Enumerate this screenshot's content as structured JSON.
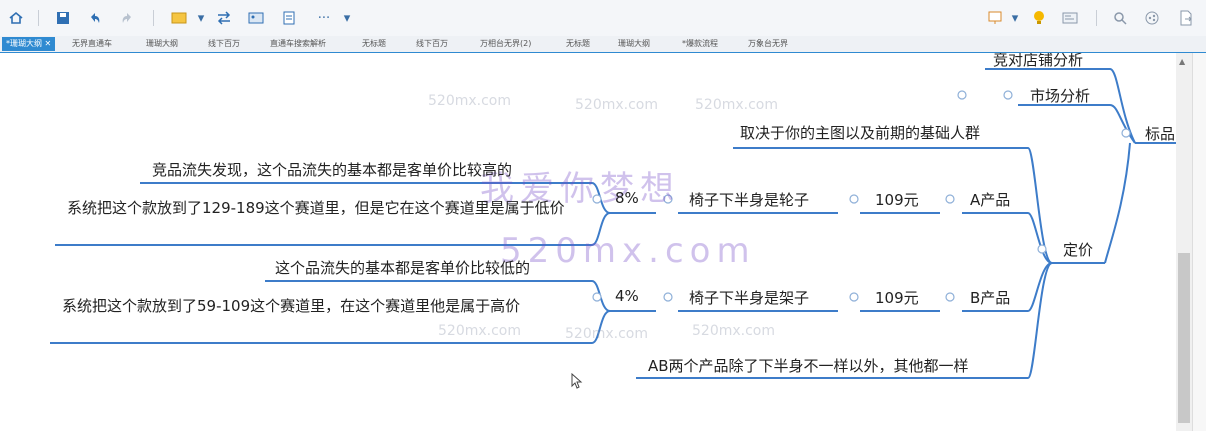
{
  "tabs": [
    {
      "label": "*珊瑚大纲 ✕",
      "active": true
    },
    {
      "label": "无界直通车",
      "active": false
    },
    {
      "label": "珊瑚大纲",
      "active": false
    },
    {
      "label": "线下百万",
      "active": false
    },
    {
      "label": "直通车搜索解析",
      "active": false
    },
    {
      "label": "无标题",
      "active": false
    },
    {
      "label": "线下百万",
      "active": false
    },
    {
      "label": "万相台无界(2)",
      "active": false
    },
    {
      "label": "无标题",
      "active": false
    },
    {
      "label": "珊瑚大纲",
      "active": false
    },
    {
      "label": "*爆款流程",
      "active": false
    },
    {
      "label": "万象台无界",
      "active": false
    }
  ],
  "mindmap": {
    "competitor_analysis": "竞对店铺分析",
    "market_analysis": "市场分析",
    "root_partial": "标品",
    "depends_on": "取决于你的主图以及前期的基础人群",
    "pricing": "定价",
    "product_a": "A产品",
    "price_a": "109元",
    "chair_a": "椅子下半身是轮子",
    "pct_a": "8%",
    "loss_a": "竞品流失发现，这个品流失的基本都是客单价比较高的",
    "system_a": "系统把这个款放到了129-189这个赛道里，但是它在这个赛道里是属于低价",
    "product_b": "B产品",
    "price_b": "109元",
    "chair_b": "椅子下半身是架子",
    "pct_b": "4%",
    "loss_b": "这个品流失的基本都是客单价比较低的",
    "system_b": "系统把这个款放到了59-109这个赛道里，在这个赛道里他是属于高价",
    "ab_diff": "AB两个产品除了下半身不一样以外，其他都一样"
  },
  "watermarks": {
    "small": "520mx.com",
    "big_cn": "我爱你梦想",
    "big_en": "520mx.com"
  },
  "colors": {
    "branch": "#3d7cc9",
    "accent": "#2f8ad1"
  }
}
